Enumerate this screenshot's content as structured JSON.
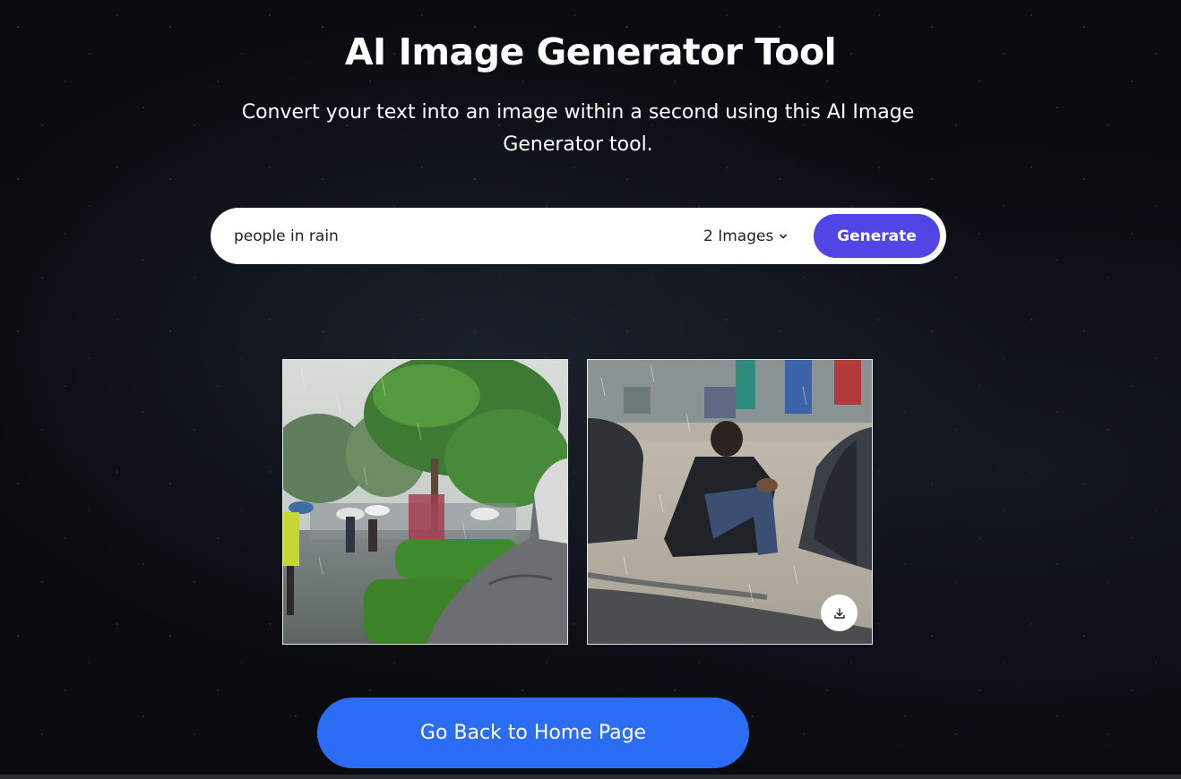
{
  "header": {
    "title": "AI Image Generator Tool",
    "subtitle": "Convert your text into an image within a second using this AI Image Generator tool."
  },
  "prompt": {
    "value": "people in rain",
    "image_count": "2 Images",
    "generate_label": "Generate"
  },
  "results": [
    {
      "name": "generated-image-1",
      "icon": "none"
    },
    {
      "name": "generated-image-2",
      "icon": "download-icon"
    }
  ],
  "footer": {
    "home_label": "Go Back to Home Page"
  },
  "colors": {
    "background": "#090b10",
    "generate_button": "#4f46e5",
    "home_button": "#2a6df4"
  }
}
